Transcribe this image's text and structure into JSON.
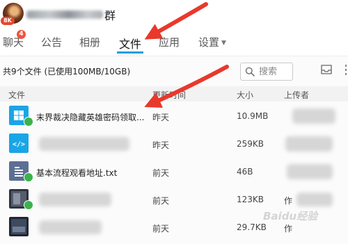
{
  "header": {
    "group_name_tail": "群",
    "level_badge": "8K"
  },
  "tabs": [
    {
      "label": "聊天",
      "badge": "4"
    },
    {
      "label": "公告"
    },
    {
      "label": "相册"
    },
    {
      "label": "文件",
      "active": true
    },
    {
      "label": "应用"
    },
    {
      "label": "设置"
    }
  ],
  "toolbar": {
    "file_count": "共9个文件 (已使用100MB/10GB)",
    "search_placeholder": "搜索"
  },
  "columns": {
    "file": "文件",
    "modified": "更新时间",
    "size": "大小",
    "uploader": "上传者"
  },
  "rows": [
    {
      "name": "末界裁决隐藏英雄密码领取...",
      "date": "昨天",
      "size": "10.9MB",
      "uploader": "",
      "icon": "windows-file-icon",
      "checked": true
    },
    {
      "name": "",
      "date": "昨天",
      "size": "259KB",
      "uploader": "",
      "icon": "code-file-icon",
      "checked": false
    },
    {
      "name": "基本流程观看地址.txt",
      "date": "前天",
      "size": "46B",
      "uploader": "",
      "icon": "text-file-icon",
      "checked": true
    },
    {
      "name": "",
      "date": "前天",
      "size": "123KB",
      "uploader": "作",
      "icon": "image-file-icon",
      "checked": true
    },
    {
      "name": "",
      "date": "前天",
      "size": "29.7KB",
      "uploader": "作",
      "icon": "image-file-icon",
      "checked": false
    }
  ],
  "colors": {
    "accent": "#1a9fe0",
    "arrow": "#e8392c",
    "badge": "#f0533e",
    "check": "#3bb24b"
  },
  "watermark": "Baidu经验"
}
